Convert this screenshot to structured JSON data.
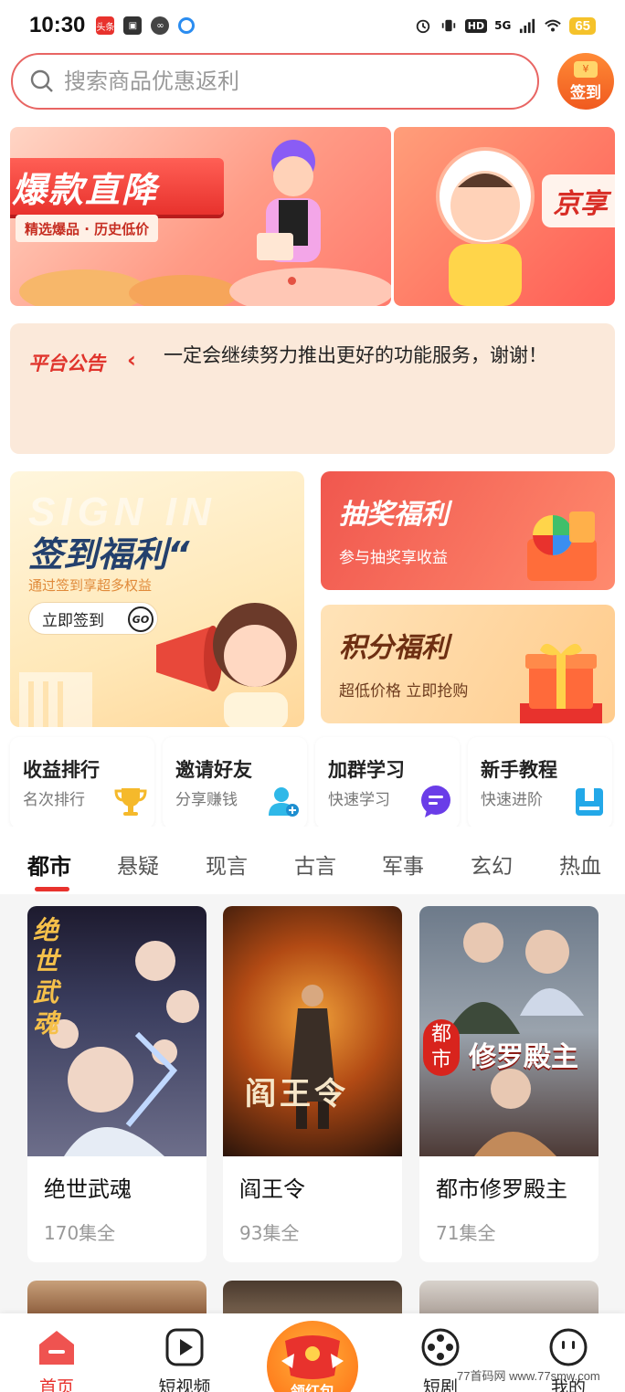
{
  "status_bar": {
    "time": "10:30",
    "app_badge": "头条",
    "network": "5G",
    "hd": "HD",
    "battery": "65"
  },
  "search": {
    "placeholder": "搜索商品优惠返利"
  },
  "signin_button": {
    "label": "签到",
    "coin_symbol": "¥"
  },
  "banner": {
    "slide1_title": "爆款直降",
    "slide1_subtitle": "精选爆品 · 历史低价",
    "slide2_title": "京享",
    "active_index": 0
  },
  "notice": {
    "label": "平台公告",
    "text": "一定会继续努力推出更好的功能服务，谢谢！"
  },
  "sign_card": {
    "watermark": "SIGN IN",
    "title": "签到福利“",
    "subtitle": "通过签到享超多权益",
    "button": "立即签到",
    "go": "GO"
  },
  "lottery_card": {
    "title": "抽奖福利",
    "subtitle": "参与抽奖享收益"
  },
  "points_card": {
    "title": "积分福利",
    "subtitle": "超低价格 立即抢购"
  },
  "features": [
    {
      "title": "收益排行",
      "subtitle": "名次排行",
      "icon": "trophy-icon",
      "color": "#f5b92b"
    },
    {
      "title": "邀请好友",
      "subtitle": "分享赚钱",
      "icon": "add-friend-icon",
      "color": "#2fb8e8"
    },
    {
      "title": "加群学习",
      "subtitle": "快速学习",
      "icon": "chat-icon",
      "color": "#6a3de8"
    },
    {
      "title": "新手教程",
      "subtitle": "快速进阶",
      "icon": "tutorial-icon",
      "color": "#23a8e8"
    }
  ],
  "categories": [
    "都市",
    "悬疑",
    "现言",
    "古言",
    "军事",
    "玄幻",
    "热血"
  ],
  "active_category": "都市",
  "dramas": [
    {
      "title": "绝世武魂",
      "episodes": "170集全",
      "poster_text": "绝世武魂"
    },
    {
      "title": "阎王令",
      "episodes": "93集全",
      "poster_text": "阎王令"
    },
    {
      "title": "都市修罗殿主",
      "episodes": "71集全",
      "poster_text": "修罗殿主",
      "poster_tag": "都市"
    }
  ],
  "bottom_nav": [
    {
      "label": "首页",
      "icon": "home-icon",
      "active": true
    },
    {
      "label": "短视频",
      "icon": "play-icon",
      "active": false
    },
    {
      "label": "领红包",
      "icon": "red-packet-icon",
      "active": false
    },
    {
      "label": "短剧",
      "icon": "film-reel-icon",
      "active": false
    },
    {
      "label": "我的",
      "icon": "profile-icon",
      "active": false
    }
  ],
  "watermark": "77首码网 www.77smw.com",
  "colors": {
    "accent": "#e8322d",
    "search_border": "#e86563",
    "notice_bg": "#fbe9da"
  }
}
